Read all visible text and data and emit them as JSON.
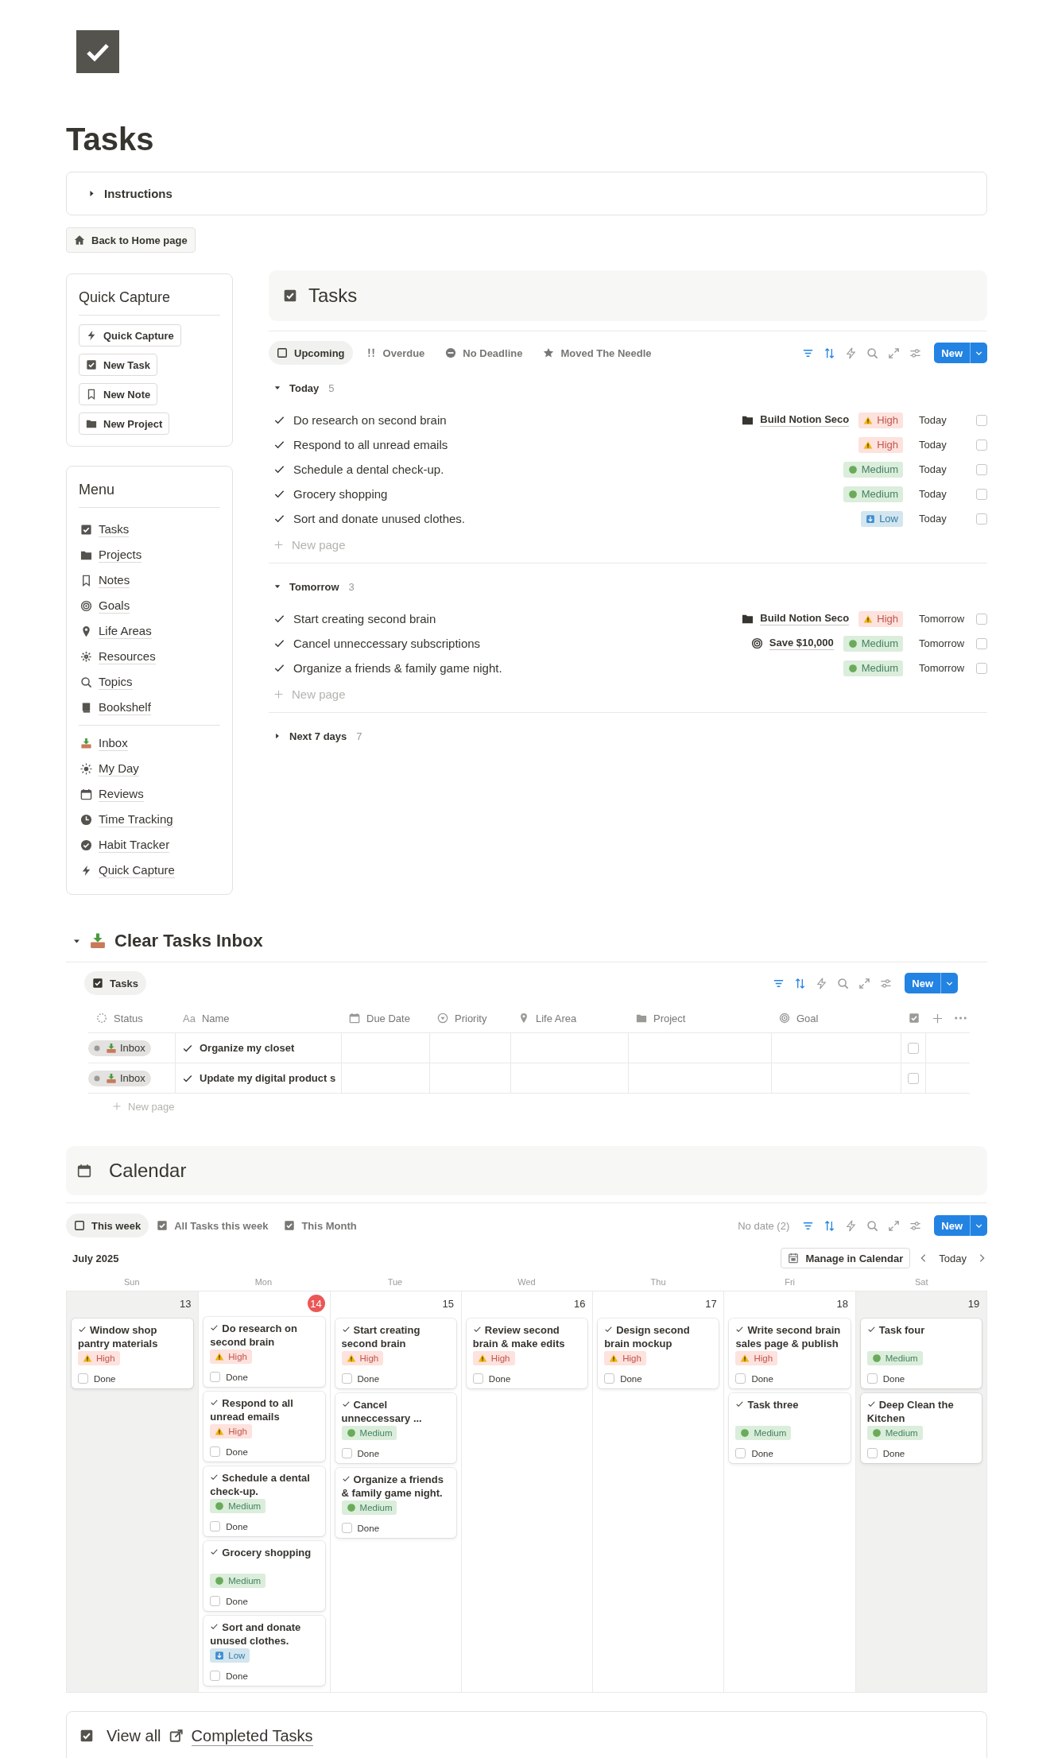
{
  "page": {
    "title": "Tasks"
  },
  "instructions": {
    "label": "Instructions",
    "expanded": false
  },
  "home_button": "Back to Home page",
  "quick_capture": {
    "title": "Quick Capture",
    "buttons": [
      {
        "label": "Quick Capture",
        "kind": "bolt"
      },
      {
        "label": "New Task",
        "kind": "checkbox"
      },
      {
        "label": "New Note",
        "kind": "bookmark"
      },
      {
        "label": "New Project",
        "kind": "folder"
      }
    ]
  },
  "menu": {
    "title": "Menu",
    "groups": [
      [
        {
          "label": "Tasks",
          "kind": "checkbox"
        },
        {
          "label": "Projects",
          "kind": "folder"
        },
        {
          "label": "Notes",
          "kind": "bookmark"
        },
        {
          "label": "Goals",
          "kind": "target"
        },
        {
          "label": "Life Areas",
          "kind": "pin"
        },
        {
          "label": "Resources",
          "kind": "asterisk"
        },
        {
          "label": "Topics",
          "kind": "search"
        },
        {
          "label": "Bookshelf",
          "kind": "book"
        }
      ],
      [
        {
          "label": "Inbox",
          "kind": "inbox"
        },
        {
          "label": "My Day",
          "kind": "sun"
        },
        {
          "label": "Reviews",
          "kind": "calendar"
        },
        {
          "label": "Time Tracking",
          "kind": "clock"
        },
        {
          "label": "Habit Tracker",
          "kind": "checkcircle"
        },
        {
          "label": "Quick Capture",
          "kind": "bolt"
        }
      ]
    ]
  },
  "tasks_view": {
    "title": "Tasks",
    "tabs": [
      {
        "label": "Upcoming",
        "kind": "square",
        "selected": true
      },
      {
        "label": "Overdue",
        "kind": "exclaim",
        "selected": false
      },
      {
        "label": "No Deadline",
        "kind": "minuscircle",
        "selected": false
      },
      {
        "label": "Moved The Needle",
        "kind": "star",
        "selected": false
      }
    ],
    "new_button": "New",
    "groups": [
      {
        "label": "Today",
        "count": "5",
        "expanded": true,
        "new_page": "New page",
        "rows": [
          {
            "name": "Do research on second brain",
            "project": "Build Notion Seco",
            "priority": {
              "label": "High",
              "kind": "high"
            },
            "date": "Today",
            "done": false
          },
          {
            "name": "Respond to all unread emails",
            "priority": {
              "label": "High",
              "kind": "high"
            },
            "date": "Today",
            "done": false
          },
          {
            "name": "Schedule a dental check-up.",
            "priority": {
              "label": "Medium",
              "kind": "medium"
            },
            "date": "Today",
            "done": false
          },
          {
            "name": "Grocery shopping",
            "priority": {
              "label": "Medium",
              "kind": "medium"
            },
            "date": "Today",
            "done": false
          },
          {
            "name": "Sort and donate unused clothes.",
            "priority": {
              "label": "Low",
              "kind": "low"
            },
            "date": "Today",
            "done": false
          }
        ]
      },
      {
        "label": "Tomorrow",
        "count": "3",
        "expanded": true,
        "new_page": "New page",
        "rows": [
          {
            "name": "Start creating second brain",
            "project": "Build Notion Seco",
            "priority": {
              "label": "High",
              "kind": "high"
            },
            "date": "Tomorrow",
            "done": false
          },
          {
            "name": "Cancel unneccessary subscriptions",
            "goal": "Save $10,000",
            "priority": {
              "label": "Medium",
              "kind": "medium"
            },
            "date": "Tomorrow",
            "done": false
          },
          {
            "name": "Organize a friends & family game night.",
            "priority": {
              "label": "Medium",
              "kind": "medium"
            },
            "date": "Tomorrow",
            "done": false
          }
        ]
      },
      {
        "label": "Next 7 days",
        "count": "7",
        "expanded": false
      }
    ]
  },
  "inbox": {
    "title": "Clear Tasks Inbox",
    "expanded": true,
    "tab": {
      "label": "Tasks",
      "selected": true
    },
    "new_button": "New",
    "columns": [
      {
        "label": "Status",
        "kind": "status"
      },
      {
        "label": "Name",
        "kind": "text",
        "glyph": "Aa"
      },
      {
        "label": "Due Date",
        "kind": "date"
      },
      {
        "label": "Priority",
        "kind": "select"
      },
      {
        "label": "Life Area",
        "kind": "place"
      },
      {
        "label": "Project",
        "kind": "relation"
      },
      {
        "label": "Goal",
        "kind": "goal"
      },
      {
        "kind": "checkbox"
      }
    ],
    "rows": [
      {
        "status": "Inbox",
        "name": "Organize my closet",
        "done": false
      },
      {
        "status": "Inbox",
        "name": "Update my digital product s",
        "done": false
      }
    ],
    "new_page": "New page"
  },
  "calendar": {
    "title": "Calendar",
    "tabs": [
      {
        "label": "This week",
        "kind": "square",
        "selected": true
      },
      {
        "label": "All Tasks this week",
        "kind": "checkbox",
        "selected": false
      },
      {
        "label": "This Month",
        "kind": "checkbox",
        "selected": false
      }
    ],
    "no_date": "No date (2)",
    "new_button": "New",
    "month": "July 2025",
    "manage_button": "Manage in Calendar",
    "today_button": "Today",
    "days": [
      {
        "name": "Sun",
        "date": "13",
        "today": false,
        "weekend": true,
        "cards": [
          {
            "title": "Window shop pantry materials",
            "priority": {
              "label": "High",
              "kind": "high"
            },
            "done_label": "Done",
            "done": false
          }
        ]
      },
      {
        "name": "Mon",
        "date": "14",
        "today": true,
        "weekend": false,
        "cards": [
          {
            "title": "Do research on second brain",
            "priority": {
              "label": "High",
              "kind": "high"
            },
            "done_label": "Done",
            "done": false
          },
          {
            "title": "Respond to all unread emails",
            "priority": {
              "label": "High",
              "kind": "high"
            },
            "done_label": "Done",
            "done": false
          },
          {
            "title": "Schedule a dental check-up.",
            "priority": {
              "label": "Medium",
              "kind": "medium"
            },
            "done_label": "Done",
            "done": false
          },
          {
            "title": "Grocery shopping",
            "priority": {
              "label": "Medium",
              "kind": "medium"
            },
            "done_label": "Done",
            "done": false
          },
          {
            "title": "Sort and donate unused clothes.",
            "priority": {
              "label": "Low",
              "kind": "low"
            },
            "done_label": "Done",
            "done": false
          }
        ]
      },
      {
        "name": "Tue",
        "date": "15",
        "today": false,
        "weekend": false,
        "cards": [
          {
            "title": "Start creating second brain",
            "priority": {
              "label": "High",
              "kind": "high"
            },
            "done_label": "Done",
            "done": false
          },
          {
            "title": "Cancel unneccessary ...",
            "priority": {
              "label": "Medium",
              "kind": "medium"
            },
            "done_label": "Done",
            "done": false
          },
          {
            "title": "Organize a friends & family game night.",
            "priority": {
              "label": "Medium",
              "kind": "medium"
            },
            "done_label": "Done",
            "done": false
          }
        ]
      },
      {
        "name": "Wed",
        "date": "16",
        "today": false,
        "weekend": false,
        "cards": [
          {
            "title": "Review second brain & make edits",
            "priority": {
              "label": "High",
              "kind": "high"
            },
            "done_label": "Done",
            "done": false
          }
        ]
      },
      {
        "name": "Thu",
        "date": "17",
        "today": false,
        "weekend": false,
        "cards": [
          {
            "title": "Design second brain mockup",
            "priority": {
              "label": "High",
              "kind": "high"
            },
            "done_label": "Done",
            "done": false
          }
        ]
      },
      {
        "name": "Fri",
        "date": "18",
        "today": false,
        "weekend": false,
        "cards": [
          {
            "title": "Write second brain sales page & publish",
            "priority": {
              "label": "High",
              "kind": "high"
            },
            "done_label": "Done",
            "done": false
          },
          {
            "title": "Task three",
            "priority": {
              "label": "Medium",
              "kind": "medium"
            },
            "done_label": "Done",
            "done": false
          }
        ]
      },
      {
        "name": "Sat",
        "date": "19",
        "today": false,
        "weekend": true,
        "cards": [
          {
            "title": "Task four",
            "priority": {
              "label": "Medium",
              "kind": "medium"
            },
            "done_label": "Done",
            "done": false
          },
          {
            "title": "Deep Clean the Kitchen",
            "priority": {
              "label": "Medium",
              "kind": "medium"
            },
            "done_label": "Done",
            "done": false
          }
        ]
      }
    ]
  },
  "footer": {
    "prefix": "View all",
    "link": "Completed Tasks"
  }
}
